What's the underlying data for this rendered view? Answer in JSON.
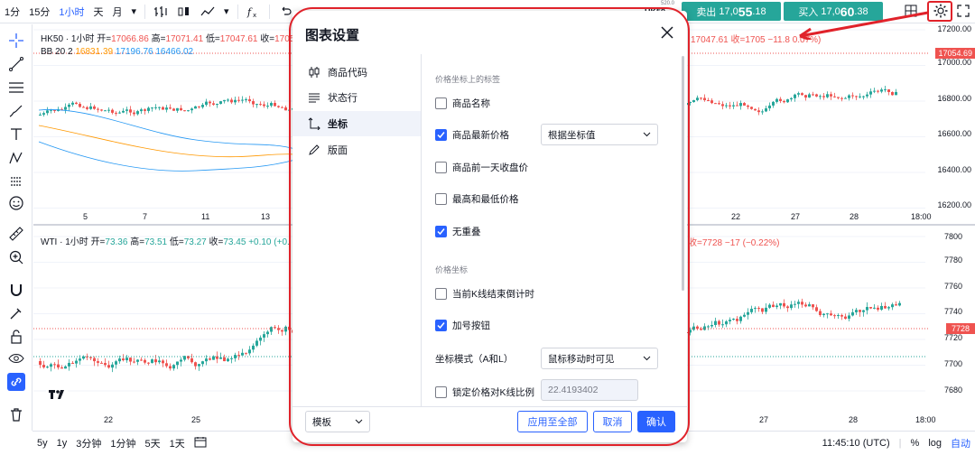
{
  "topbar": {
    "intervals": [
      "1分",
      "15分",
      "1小时",
      "天",
      "月"
    ],
    "active_interval": "1小时",
    "symbol": "HK50",
    "tiny_label": "520.0",
    "sell_label": "卖出",
    "sell_price_a": "17,0",
    "sell_price_b": "55",
    "sell_price_c": ".18",
    "buy_label": "买入",
    "buy_price_a": "17,0",
    "buy_price_b": "60",
    "buy_price_c": ".38"
  },
  "pane1": {
    "legend_title": "HK50 · 1小时",
    "o_label": "开=",
    "o_value": "17066.86",
    "h_label": "高=",
    "h_value": "17071.41",
    "l_label": "低=",
    "l_value": "17047.61",
    "c_label": "收=",
    "c_value": "1705",
    "right_legend": "17047.61  收=1705",
    "right_change": "−11.8",
    "right_pct": "0.07%)",
    "bb_label": "BB 20 2",
    "bb_v1": "16831.39",
    "bb_v2": "17196.76",
    "bb_v3": "16466.02",
    "price_axis": [
      "17200.00",
      "17000.00",
      "16800.00",
      "16600.00",
      "16400.00",
      "16200.00"
    ],
    "last_price": "17054.69",
    "x_left": [
      "5",
      "7",
      "11",
      "13"
    ],
    "x_right": [
      "22",
      "27",
      "28",
      "18:00"
    ]
  },
  "pane2": {
    "legend_title": "WTI · 1小时",
    "o_label": "开=",
    "o_value": "73.36",
    "h_label": "高=",
    "h_value": "73.51",
    "l_label": "低=",
    "l_value": "73.27",
    "c_label": "收=",
    "c_value": "73.45",
    "change": "+0.10",
    "pct": "(+0.",
    "right_legend": "收=7728",
    "right_change": "−17 (−0.22%)",
    "price_axis": [
      "7800",
      "7780",
      "7760",
      "7740",
      "7720",
      "7700",
      "7680"
    ],
    "last_price": "7728",
    "x_left": [
      "22",
      "25"
    ],
    "x_right": [
      "27",
      "28",
      "18:00"
    ]
  },
  "bottombar": {
    "ranges": [
      "5y",
      "1y",
      "3分钟",
      "1分钟",
      "5天",
      "1天"
    ],
    "clock": "11:45:10 (UTC)",
    "pct": "%",
    "log": "log",
    "auto": "自动"
  },
  "dialog": {
    "title": "图表设置",
    "nav": [
      "商品代码",
      "状态行",
      "坐标",
      "版面"
    ],
    "active_nav": "坐标",
    "section1_title": "价格坐标上的标签",
    "section2_title": "价格坐标",
    "options": {
      "symbol_name": "商品名称",
      "last_price": "商品最新价格",
      "last_price_mode": "根据坐标值",
      "prev_close": "商品前一天收盘价",
      "high_low": "最高和最低价格",
      "no_overlap": "无重叠",
      "countdown": "当前K线结束倒计时",
      "plus_button": "加号按钮",
      "scale_mode_label": "坐标模式（A和L）",
      "scale_mode_value": "鼠标移动时可见",
      "lock_ratio": "锁定价格对K线比例",
      "lock_ratio_value": "22.4193402"
    },
    "footer": {
      "template": "模板",
      "apply_all": "应用至全部",
      "cancel": "取消",
      "ok": "确认"
    }
  },
  "colors": {
    "accent": "#2962ff",
    "up": "#26a69a",
    "down": "#ef5350",
    "highlight": "#e0222a"
  }
}
